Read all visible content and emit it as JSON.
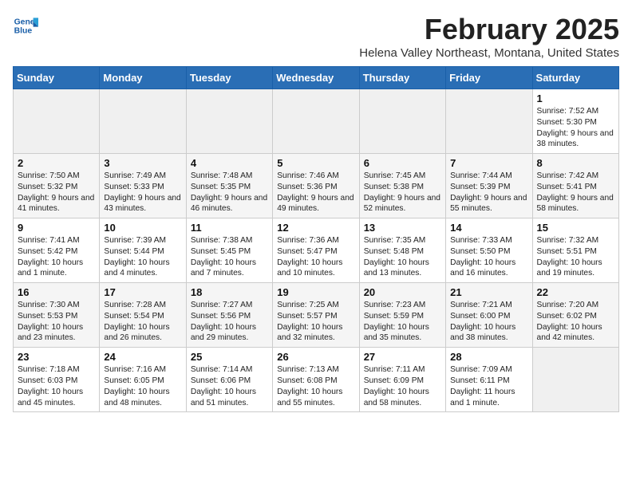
{
  "logo": {
    "text_general": "General",
    "text_blue": "Blue"
  },
  "header": {
    "title": "February 2025",
    "subtitle": "Helena Valley Northeast, Montana, United States"
  },
  "weekdays": [
    "Sunday",
    "Monday",
    "Tuesday",
    "Wednesday",
    "Thursday",
    "Friday",
    "Saturday"
  ],
  "weeks": [
    [
      {
        "day": "",
        "detail": ""
      },
      {
        "day": "",
        "detail": ""
      },
      {
        "day": "",
        "detail": ""
      },
      {
        "day": "",
        "detail": ""
      },
      {
        "day": "",
        "detail": ""
      },
      {
        "day": "",
        "detail": ""
      },
      {
        "day": "1",
        "detail": "Sunrise: 7:52 AM\nSunset: 5:30 PM\nDaylight: 9 hours and 38 minutes."
      }
    ],
    [
      {
        "day": "2",
        "detail": "Sunrise: 7:50 AM\nSunset: 5:32 PM\nDaylight: 9 hours and 41 minutes."
      },
      {
        "day": "3",
        "detail": "Sunrise: 7:49 AM\nSunset: 5:33 PM\nDaylight: 9 hours and 43 minutes."
      },
      {
        "day": "4",
        "detail": "Sunrise: 7:48 AM\nSunset: 5:35 PM\nDaylight: 9 hours and 46 minutes."
      },
      {
        "day": "5",
        "detail": "Sunrise: 7:46 AM\nSunset: 5:36 PM\nDaylight: 9 hours and 49 minutes."
      },
      {
        "day": "6",
        "detail": "Sunrise: 7:45 AM\nSunset: 5:38 PM\nDaylight: 9 hours and 52 minutes."
      },
      {
        "day": "7",
        "detail": "Sunrise: 7:44 AM\nSunset: 5:39 PM\nDaylight: 9 hours and 55 minutes."
      },
      {
        "day": "8",
        "detail": "Sunrise: 7:42 AM\nSunset: 5:41 PM\nDaylight: 9 hours and 58 minutes."
      }
    ],
    [
      {
        "day": "9",
        "detail": "Sunrise: 7:41 AM\nSunset: 5:42 PM\nDaylight: 10 hours and 1 minute."
      },
      {
        "day": "10",
        "detail": "Sunrise: 7:39 AM\nSunset: 5:44 PM\nDaylight: 10 hours and 4 minutes."
      },
      {
        "day": "11",
        "detail": "Sunrise: 7:38 AM\nSunset: 5:45 PM\nDaylight: 10 hours and 7 minutes."
      },
      {
        "day": "12",
        "detail": "Sunrise: 7:36 AM\nSunset: 5:47 PM\nDaylight: 10 hours and 10 minutes."
      },
      {
        "day": "13",
        "detail": "Sunrise: 7:35 AM\nSunset: 5:48 PM\nDaylight: 10 hours and 13 minutes."
      },
      {
        "day": "14",
        "detail": "Sunrise: 7:33 AM\nSunset: 5:50 PM\nDaylight: 10 hours and 16 minutes."
      },
      {
        "day": "15",
        "detail": "Sunrise: 7:32 AM\nSunset: 5:51 PM\nDaylight: 10 hours and 19 minutes."
      }
    ],
    [
      {
        "day": "16",
        "detail": "Sunrise: 7:30 AM\nSunset: 5:53 PM\nDaylight: 10 hours and 23 minutes."
      },
      {
        "day": "17",
        "detail": "Sunrise: 7:28 AM\nSunset: 5:54 PM\nDaylight: 10 hours and 26 minutes."
      },
      {
        "day": "18",
        "detail": "Sunrise: 7:27 AM\nSunset: 5:56 PM\nDaylight: 10 hours and 29 minutes."
      },
      {
        "day": "19",
        "detail": "Sunrise: 7:25 AM\nSunset: 5:57 PM\nDaylight: 10 hours and 32 minutes."
      },
      {
        "day": "20",
        "detail": "Sunrise: 7:23 AM\nSunset: 5:59 PM\nDaylight: 10 hours and 35 minutes."
      },
      {
        "day": "21",
        "detail": "Sunrise: 7:21 AM\nSunset: 6:00 PM\nDaylight: 10 hours and 38 minutes."
      },
      {
        "day": "22",
        "detail": "Sunrise: 7:20 AM\nSunset: 6:02 PM\nDaylight: 10 hours and 42 minutes."
      }
    ],
    [
      {
        "day": "23",
        "detail": "Sunrise: 7:18 AM\nSunset: 6:03 PM\nDaylight: 10 hours and 45 minutes."
      },
      {
        "day": "24",
        "detail": "Sunrise: 7:16 AM\nSunset: 6:05 PM\nDaylight: 10 hours and 48 minutes."
      },
      {
        "day": "25",
        "detail": "Sunrise: 7:14 AM\nSunset: 6:06 PM\nDaylight: 10 hours and 51 minutes."
      },
      {
        "day": "26",
        "detail": "Sunrise: 7:13 AM\nSunset: 6:08 PM\nDaylight: 10 hours and 55 minutes."
      },
      {
        "day": "27",
        "detail": "Sunrise: 7:11 AM\nSunset: 6:09 PM\nDaylight: 10 hours and 58 minutes."
      },
      {
        "day": "28",
        "detail": "Sunrise: 7:09 AM\nSunset: 6:11 PM\nDaylight: 11 hours and 1 minute."
      },
      {
        "day": "",
        "detail": ""
      }
    ]
  ]
}
